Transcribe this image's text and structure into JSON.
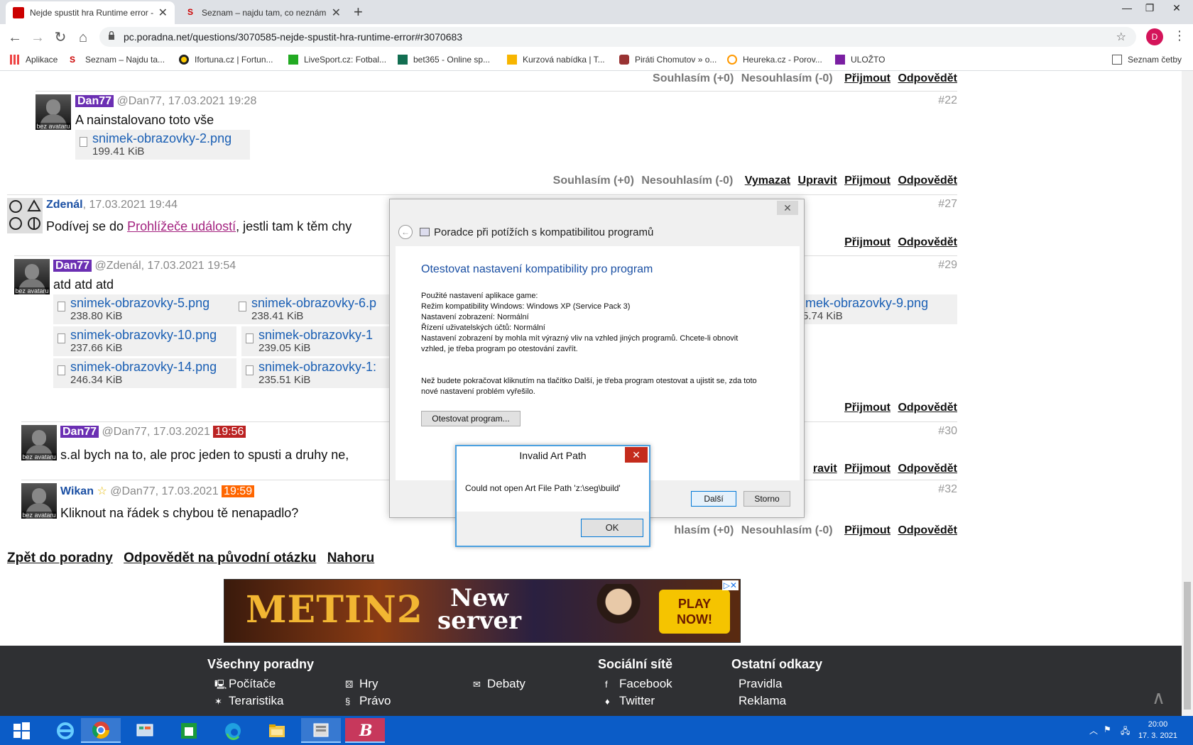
{
  "browser": {
    "tabs": [
      {
        "title": "Nejde spustit hra Runtime error - ",
        "active": true
      },
      {
        "title": "Seznam – najdu tam, co neznám",
        "active": false
      }
    ],
    "new_tab": "+",
    "url": "pc.poradna.net/questions/3070585-nejde-spustit-hra-runtime-error#r3070683",
    "profile_initial": "D",
    "bookmarks": [
      "Aplikace",
      "Seznam – Najdu ta...",
      "Ifortuna.cz | Fortun...",
      "LiveSport.cz: Fotbal...",
      "bet365 - Online sp...",
      "Kurzová nabídka | T...",
      "Piráti Chomutov » o...",
      "Heureka.cz - Porov...",
      "ULOŽTO",
      "Seznam četby"
    ]
  },
  "common": {
    "agree": "Souhlasím (+0)",
    "disagree": "Nesouhlasím (-0)",
    "accept": "Přijmout",
    "reply": "Odpovědět",
    "delete": "Vymazat",
    "edit": "Upravit",
    "no_avatar": "bez avataru"
  },
  "posts": [
    {
      "id": "#22",
      "user": "Dan77",
      "to": "@Dan77",
      "date": "17.03.2021",
      "time": "19:28",
      "text": "A nainstalovano toto vše",
      "attachments": [
        {
          "name": "snimek-obrazovky-2.png",
          "size": "199.41 KiB"
        }
      ]
    },
    {
      "id": "#27",
      "user": "Zdenál",
      "date": "17.03.2021 19:44",
      "text_before": "Podívej se do ",
      "link": "Prohlížeče událostí",
      "text_after": ", jestli tam k těm chy"
    },
    {
      "id": "#29",
      "user": "Dan77",
      "to": "@Zdenál",
      "date": "17.03.2021",
      "time": "19:54",
      "text": "atd atd atd",
      "attachments": [
        {
          "name": "snimek-obrazovky-5.png",
          "size": "238.80 KiB"
        },
        {
          "name": "snimek-obrazovky-6.p",
          "size": "238.41 KiB"
        },
        {
          "name": "imek-obrazovky-9.png",
          "size": "5.74 KiB"
        },
        {
          "name": "snimek-obrazovky-10.png",
          "size": "237.66 KiB"
        },
        {
          "name": "snimek-obrazovky-1",
          "size": "239.05 KiB"
        },
        {
          "name": "snimek-obrazovky-14.png",
          "size": "246.34 KiB"
        },
        {
          "name": "snimek-obrazovky-1:",
          "size": "235.51 KiB"
        }
      ]
    },
    {
      "id": "#30",
      "user": "Dan77",
      "to": "@Dan77",
      "date": "17.03.2021",
      "time": "19:56",
      "text": "s.al bych na to, ale proc jeden to spusti a druhy ne,",
      "partial_edit": "ravit"
    },
    {
      "id": "#32",
      "user": "Wikan",
      "to": "@Dan77",
      "date": "17.03.2021",
      "time": "19:59",
      "text": "Kliknout na řádek s chybou tě nenapadlo?",
      "partial_agree": "hlasím (+0)"
    }
  ],
  "bottom_links": [
    "Zpět do poradny",
    "Odpovědět na původní otázku",
    "Nahoru"
  ],
  "ad": {
    "logo": "METIN2",
    "headline1": "New",
    "headline2": "server",
    "cta1": "PLAY",
    "cta2": "NOW!"
  },
  "footer": {
    "col1_title": "Všechny poradny",
    "col1": [
      "Počítače",
      "Teraristika"
    ],
    "col2": [
      "Hry",
      "Právo"
    ],
    "col3": [
      "Debaty"
    ],
    "col4_title": "Sociální sítě",
    "col4": [
      "Facebook",
      "Twitter"
    ],
    "col5_title": "Ostatní odkazy",
    "col5": [
      "Pravidla",
      "Reklama"
    ]
  },
  "compat_dialog": {
    "title": "Poradce při potížích s kompatibilitou programů",
    "heading": "Otestovat nastavení kompatibility pro program",
    "lines": [
      "Použité nastavení aplikace  game:",
      "Režim kompatibility Windows: Windows XP (Service Pack 3)",
      "Nastavení zobrazení:  Normální",
      "Řízení uživatelských účtů:  Normální",
      "Nastavení zobrazení by mohla mít výrazný vliv na vzhled jiných programů. Chcete-li obnovit",
      "vzhled, je třeba program po otestování zavřít."
    ],
    "note1": "Než budete pokračovat kliknutím na tlačítko Další, je třeba program otestovat a ujistit se, zda toto",
    "note2": "nové nastavení problém vyřešilo.",
    "test_button": "Otestovat program...",
    "next_button": "Další",
    "cancel_button": "Storno"
  },
  "art_dialog": {
    "title": "Invalid Art Path",
    "message": "Could not open Art File Path 'z:\\seg\\build'",
    "ok": "OK"
  },
  "taskbar": {
    "time": "20:00",
    "date": "17. 3. 2021"
  }
}
